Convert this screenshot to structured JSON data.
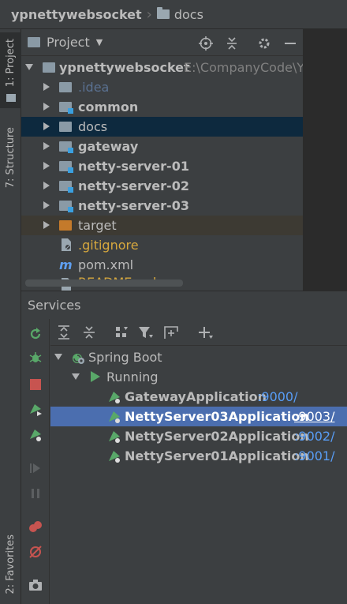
{
  "breadcrumb": {
    "project": "ypnettywebsocket",
    "folder": "docs"
  },
  "side_tabs": {
    "project": "1: Project",
    "structure": "7: Structure",
    "favorites": "2: Favorites"
  },
  "project_panel": {
    "title": "Project",
    "root": {
      "name": "ypnettywebsocket",
      "path": "E:\\CompanyCode\\Y"
    },
    "items": [
      {
        "label": ".idea"
      },
      {
        "label": "common"
      },
      {
        "label": "docs"
      },
      {
        "label": "gateway"
      },
      {
        "label": "netty-server-01"
      },
      {
        "label": "netty-server-02"
      },
      {
        "label": "netty-server-03"
      },
      {
        "label": "target"
      },
      {
        "label": ".gitignore"
      },
      {
        "label": "pom.xml"
      },
      {
        "label": "README.md"
      }
    ]
  },
  "services": {
    "title": "Services",
    "spring_boot": "Spring Boot",
    "running": "Running",
    "apps": [
      {
        "name": "GatewayApplication",
        "port": ":9000/"
      },
      {
        "name": "NettyServer03Application",
        "port": ":9003/"
      },
      {
        "name": "NettyServer02Application",
        "port": ":9002/"
      },
      {
        "name": "NettyServer01Application",
        "port": ":9001/"
      }
    ]
  },
  "colors": {
    "selection": "#4b6eaf",
    "link": "#589df6",
    "running": "#59a869",
    "stop": "#c75450"
  }
}
